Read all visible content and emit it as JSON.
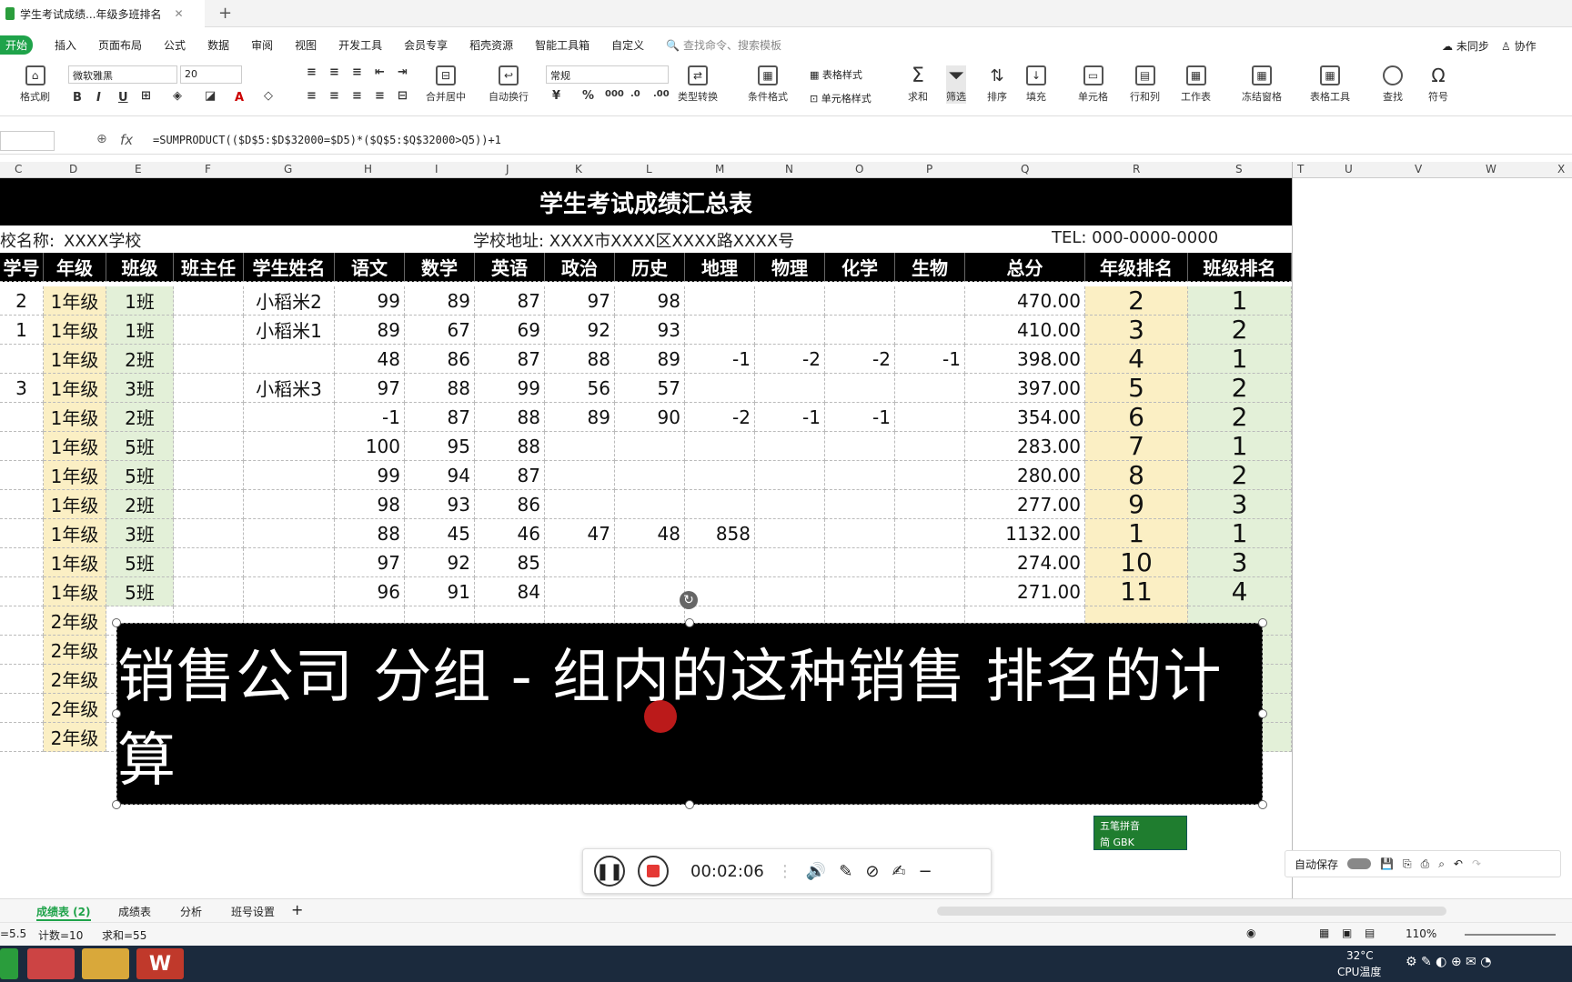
{
  "window": {
    "doc_tab": "学生考试成绩...年级多班排名"
  },
  "menu": [
    "开始",
    "插入",
    "页面布局",
    "公式",
    "数据",
    "审阅",
    "视图",
    "开发工具",
    "会员专享",
    "稻壳资源",
    "智能工具箱",
    "自定义"
  ],
  "search_placeholder": "查找命令、搜索模板",
  "top_right": {
    "sync": "未同步",
    "collab": "协作"
  },
  "ribbon": {
    "font_name": "微软雅黑",
    "font_size": "20",
    "number_format": "常规",
    "format_brush": "格式刷",
    "merge": "合并居中",
    "wrap": "自动换行",
    "convert": "类型转换",
    "cond_format": "条件格式",
    "table_style": "表格样式",
    "cell_style": "单元格样式",
    "sum": "求和",
    "filter": "筛选",
    "sort": "排序",
    "fill": "填充",
    "cell": "单元格",
    "rowcol": "行和列",
    "sheet": "工作表",
    "freeze": "冻结窗格",
    "tools": "表格工具",
    "find": "查找",
    "symbol": "符号"
  },
  "formula": "=SUMPRODUCT(($D$5:$D$32000=$D5)*($Q$5:$Q$32000>Q5))+1",
  "columns": [
    "C",
    "D",
    "E",
    "F",
    "G",
    "H",
    "I",
    "J",
    "K",
    "L",
    "M",
    "N",
    "O",
    "P",
    "Q",
    "R",
    "S",
    "T",
    "U",
    "V",
    "W",
    "X"
  ],
  "sheet_title": "学生考试成绩汇总表",
  "info": {
    "school_label": "校名称:",
    "school": "XXXX学校",
    "address": "学校地址: XXXX市XXXX区XXXX路XXXX号",
    "tel": "TEL: 000-0000-0000"
  },
  "headers": [
    "学号",
    "年级",
    "班级",
    "班主任",
    "学生姓名",
    "语文",
    "数学",
    "英语",
    "政治",
    "历史",
    "地理",
    "物理",
    "化学",
    "生物",
    "总分",
    "年级排名",
    "班级排名"
  ],
  "rows": [
    [
      "2",
      "1年级",
      "1班",
      "",
      "小稻米2",
      "99",
      "89",
      "87",
      "97",
      "98",
      "",
      "",
      "",
      "",
      "470.00",
      "2",
      "1"
    ],
    [
      "1",
      "1年级",
      "1班",
      "",
      "小稻米1",
      "89",
      "67",
      "69",
      "92",
      "93",
      "",
      "",
      "",
      "",
      "410.00",
      "3",
      "2"
    ],
    [
      "",
      "1年级",
      "2班",
      "",
      "",
      "48",
      "86",
      "87",
      "88",
      "89",
      "-1",
      "-2",
      "-2",
      "-1",
      "398.00",
      "4",
      "1"
    ],
    [
      "3",
      "1年级",
      "3班",
      "",
      "小稻米3",
      "97",
      "88",
      "99",
      "56",
      "57",
      "",
      "",
      "",
      "",
      "397.00",
      "5",
      "2"
    ],
    [
      "",
      "1年级",
      "2班",
      "",
      "",
      "-1",
      "87",
      "88",
      "89",
      "90",
      "-2",
      "-1",
      "-1",
      "",
      "354.00",
      "6",
      "2"
    ],
    [
      "",
      "1年级",
      "5班",
      "",
      "",
      "100",
      "95",
      "88",
      "",
      "",
      "",
      "",
      "",
      "",
      "283.00",
      "7",
      "1"
    ],
    [
      "",
      "1年级",
      "5班",
      "",
      "",
      "99",
      "94",
      "87",
      "",
      "",
      "",
      "",
      "",
      "",
      "280.00",
      "8",
      "2"
    ],
    [
      "",
      "1年级",
      "2班",
      "",
      "",
      "98",
      "93",
      "86",
      "",
      "",
      "",
      "",
      "",
      "",
      "277.00",
      "9",
      "3"
    ],
    [
      "",
      "1年级",
      "3班",
      "",
      "",
      "88",
      "45",
      "46",
      "47",
      "48",
      "858",
      "",
      "",
      "",
      "1132.00",
      "1",
      "1"
    ],
    [
      "",
      "1年级",
      "5班",
      "",
      "",
      "97",
      "92",
      "85",
      "",
      "",
      "",
      "",
      "",
      "",
      "274.00",
      "10",
      "3"
    ],
    [
      "",
      "1年级",
      "5班",
      "",
      "",
      "96",
      "91",
      "84",
      "",
      "",
      "",
      "",
      "",
      "",
      "271.00",
      "11",
      "4"
    ],
    [
      "",
      "2年级",
      "",
      "",
      "",
      "",
      "",
      "",
      "",
      "",
      "",
      "",
      "",
      "",
      "",
      "",
      ""
    ],
    [
      "",
      "2年级",
      "",
      "",
      "",
      "",
      "",
      "",
      "",
      "",
      "",
      "",
      "",
      "",
      "",
      "",
      ""
    ],
    [
      "",
      "2年级",
      "",
      "",
      "",
      "",
      "",
      "",
      "",
      "",
      "",
      "",
      "",
      "",
      "",
      "",
      ""
    ],
    [
      "",
      "2年级",
      "",
      "",
      "",
      "",
      "",
      "",
      "",
      "",
      "",
      "",
      "",
      "",
      "",
      "",
      ""
    ],
    [
      "",
      "2年级",
      "",
      "",
      "",
      "",
      "",
      "",
      "",
      "",
      "",
      "",
      "",
      "",
      "",
      "",
      ""
    ]
  ],
  "caption": "销售公司 分组 - 组内的这种销售 排名的计算",
  "recorder": {
    "time": "00:02:06"
  },
  "ime": {
    "line1": "五笔拼音",
    "line2": "简 GBK"
  },
  "autosave": "自动保存",
  "sheets": [
    "成绩表 (2)",
    "成绩表",
    "分析",
    "班号设置"
  ],
  "status": {
    "avg": "=5.5",
    "count": "计数=10",
    "sum": "求和=55",
    "zoom": "110%"
  },
  "taskbar": {
    "temp": "32°C",
    "cpu": "CPU温度"
  }
}
